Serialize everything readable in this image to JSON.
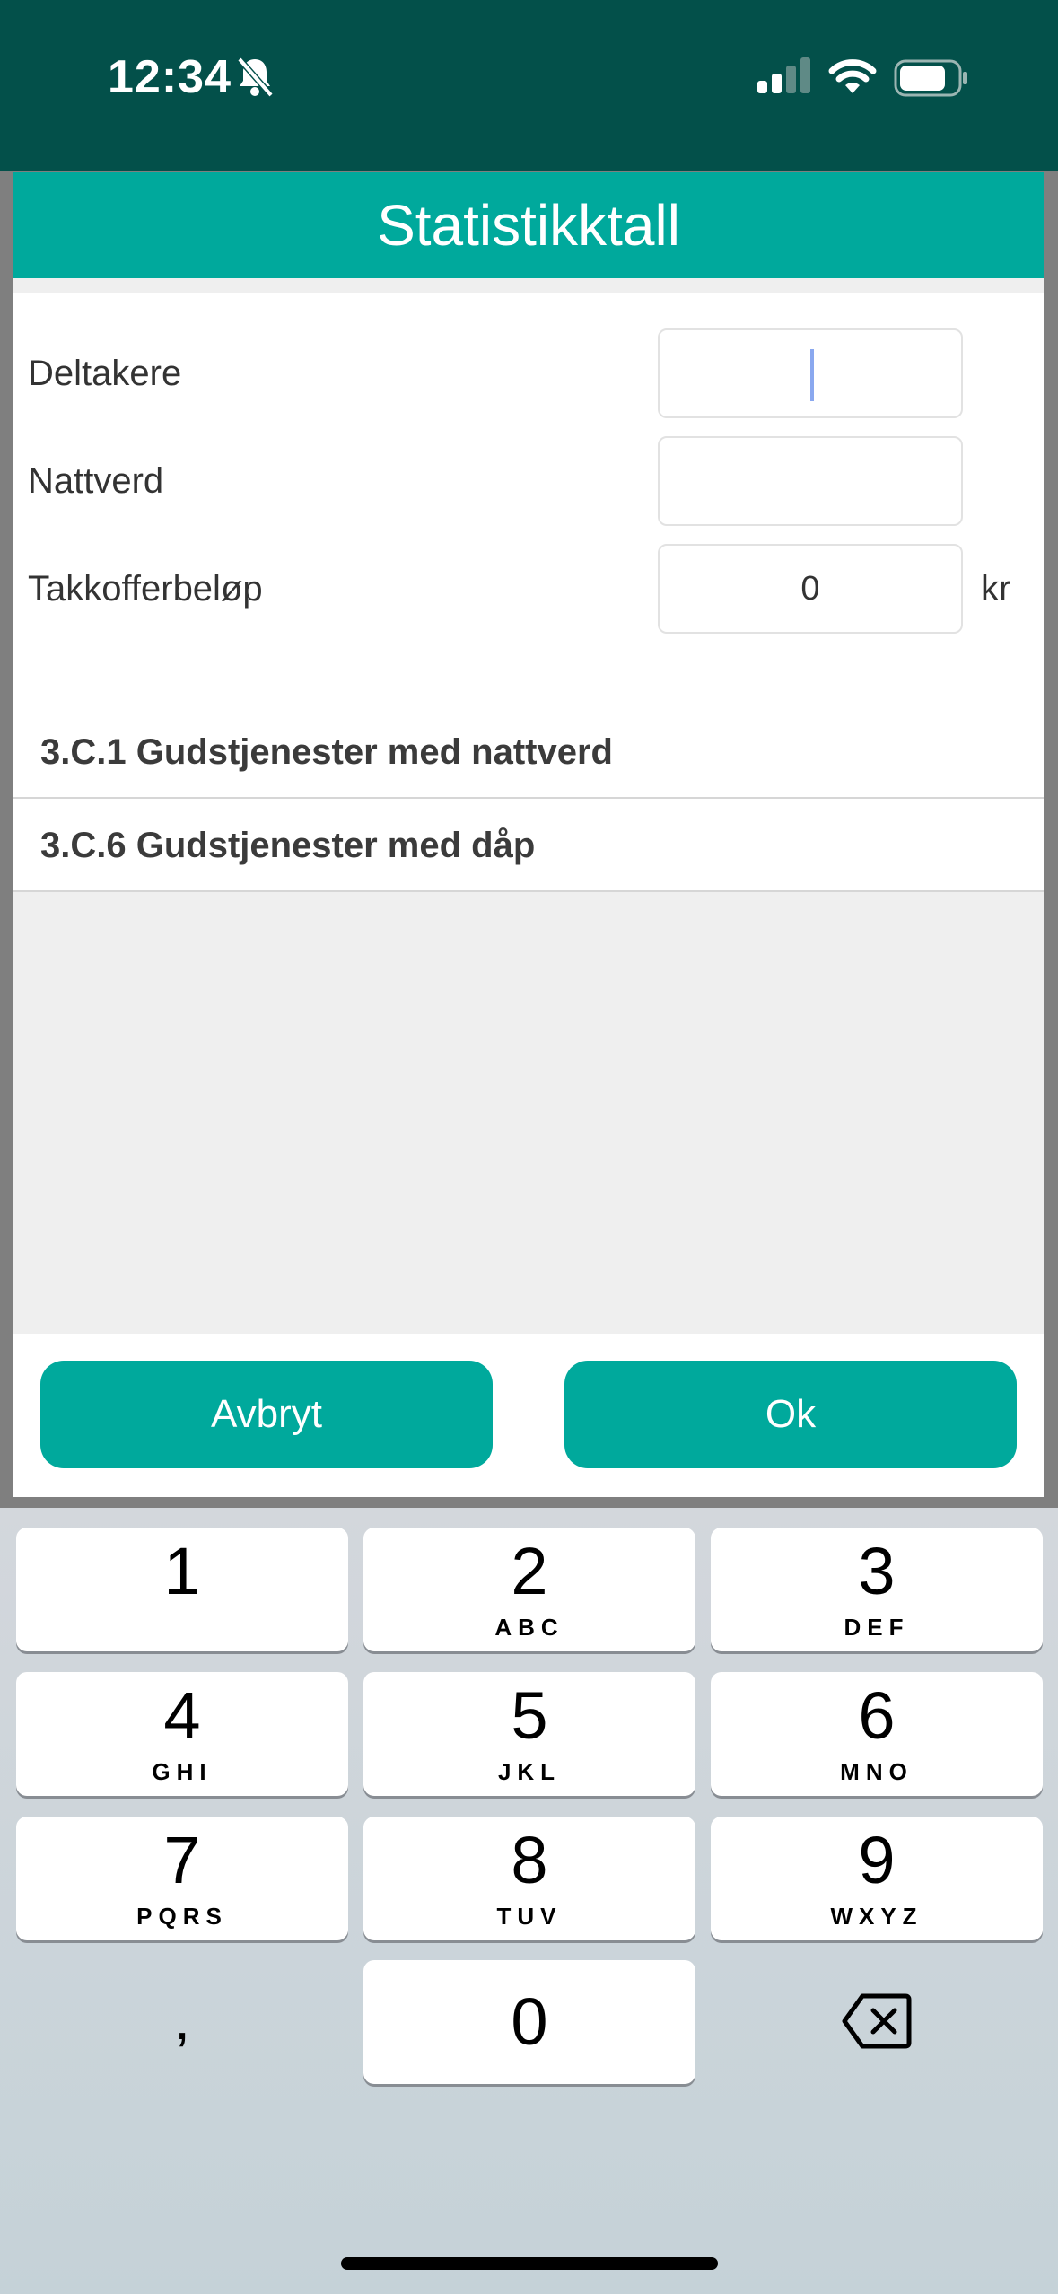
{
  "status_bar": {
    "time": "12:34"
  },
  "dialog": {
    "title": "Statistikktall",
    "fields": [
      {
        "label": "Deltakere",
        "value": ""
      },
      {
        "label": "Nattverd",
        "value": ""
      },
      {
        "label": "Takkofferbeløp",
        "value": "0",
        "unit": "kr"
      }
    ],
    "items": [
      "3.C.1 Gudstjenester med nattverd",
      "3.C.6 Gudstjenester med dåp"
    ],
    "cancel_label": "Avbryt",
    "ok_label": "Ok"
  },
  "keypad": {
    "keys": [
      {
        "digit": "1",
        "letters": ""
      },
      {
        "digit": "2",
        "letters": "ABC"
      },
      {
        "digit": "3",
        "letters": "DEF"
      },
      {
        "digit": "4",
        "letters": "GHI"
      },
      {
        "digit": "5",
        "letters": "JKL"
      },
      {
        "digit": "6",
        "letters": "MNO"
      },
      {
        "digit": "7",
        "letters": "PQRS"
      },
      {
        "digit": "8",
        "letters": "TUV"
      },
      {
        "digit": "9",
        "letters": "WXYZ"
      },
      {
        "digit": "0",
        "letters": ""
      }
    ],
    "comma": ",",
    "delete_icon": "backspace-icon"
  }
}
